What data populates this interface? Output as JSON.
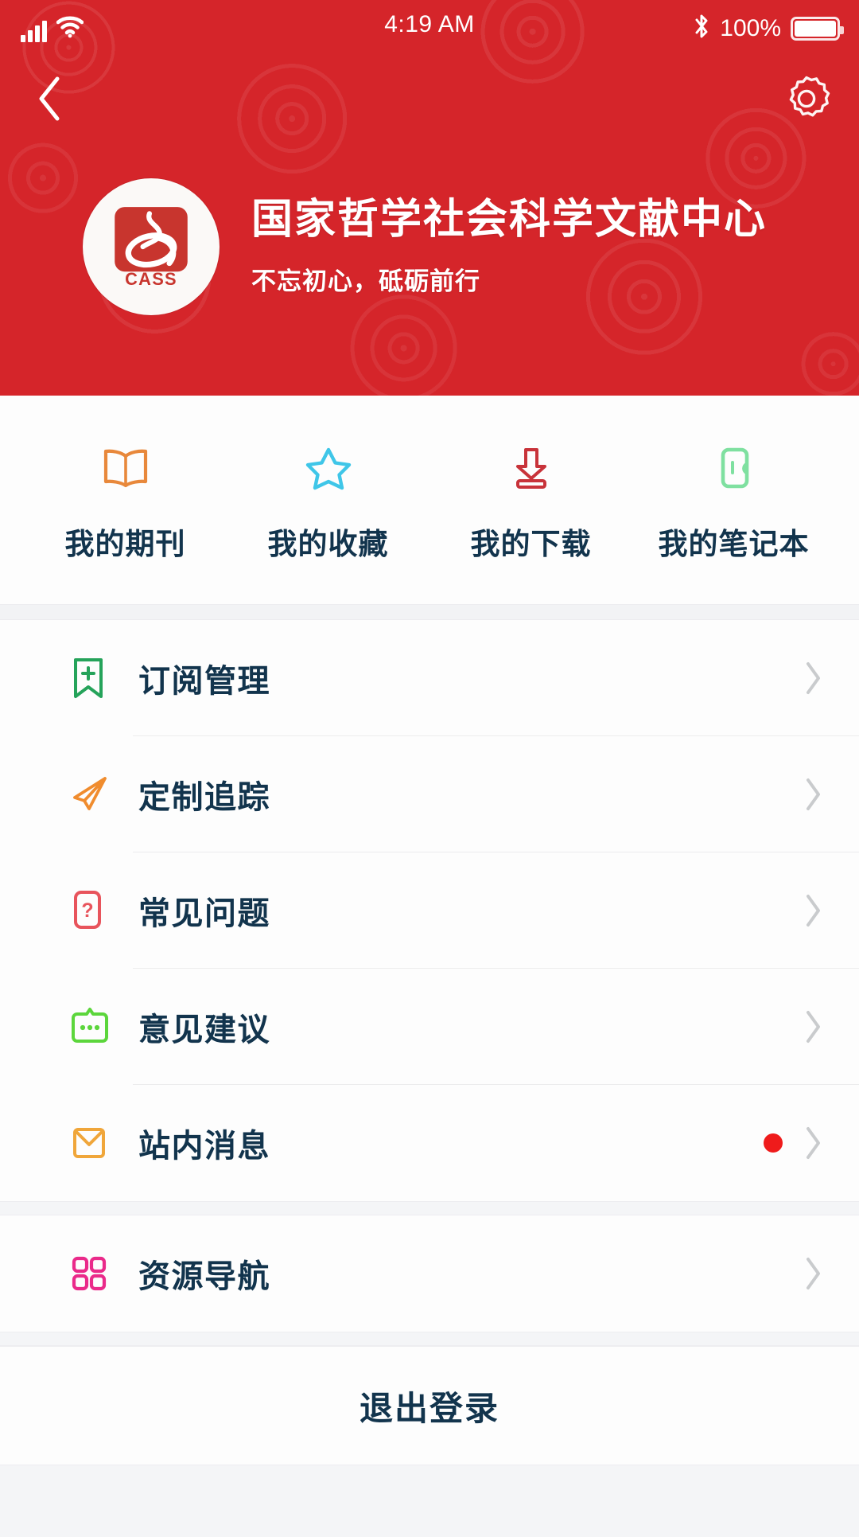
{
  "status_bar": {
    "time": "4:19 AM",
    "battery_percent": "100%",
    "signal_icon": "signal-bars-icon",
    "wifi_icon": "wifi-icon",
    "bluetooth_icon": "bluetooth-icon",
    "battery_icon": "battery-full-icon"
  },
  "header": {
    "back_icon": "back-chevron-icon",
    "settings_icon": "gear-icon",
    "logo_icon": "cass-logo-icon",
    "logo_text": "CASS",
    "title": "国家哲学社会科学文献中心",
    "subtitle": "不忘初心，砥砺前行",
    "background_color": "#d5252a"
  },
  "quick_actions": [
    {
      "label": "我的期刊",
      "icon": "open-book-icon",
      "color": "#e8883b"
    },
    {
      "label": "我的收藏",
      "icon": "star-icon",
      "color": "#3fc6e8"
    },
    {
      "label": "我的下载",
      "icon": "download-icon",
      "color": "#c8333a"
    },
    {
      "label": "我的笔记本",
      "icon": "notebook-icon",
      "color": "#7fe0a0"
    }
  ],
  "menu_groups": [
    {
      "items": [
        {
          "label": "订阅管理",
          "icon": "bookmark-plus-icon",
          "color": "#25a35a",
          "badge": false
        },
        {
          "label": "定制追踪",
          "icon": "paper-plane-icon",
          "color": "#f08c2e",
          "badge": false
        },
        {
          "label": "常见问题",
          "icon": "question-card-icon",
          "color": "#e8545c",
          "badge": false
        },
        {
          "label": "意见建议",
          "icon": "feedback-icon",
          "color": "#5cd63c",
          "badge": false
        },
        {
          "label": "站内消息",
          "icon": "envelope-icon",
          "color": "#f0a63a",
          "badge": true
        }
      ]
    },
    {
      "items": [
        {
          "label": "资源导航",
          "icon": "grid-icon",
          "color": "#ea2a8a",
          "badge": false
        }
      ]
    }
  ],
  "chevron_icon": "chevron-right-icon",
  "badge_color": "#ef1b1b",
  "logout": {
    "label": "退出登录"
  }
}
